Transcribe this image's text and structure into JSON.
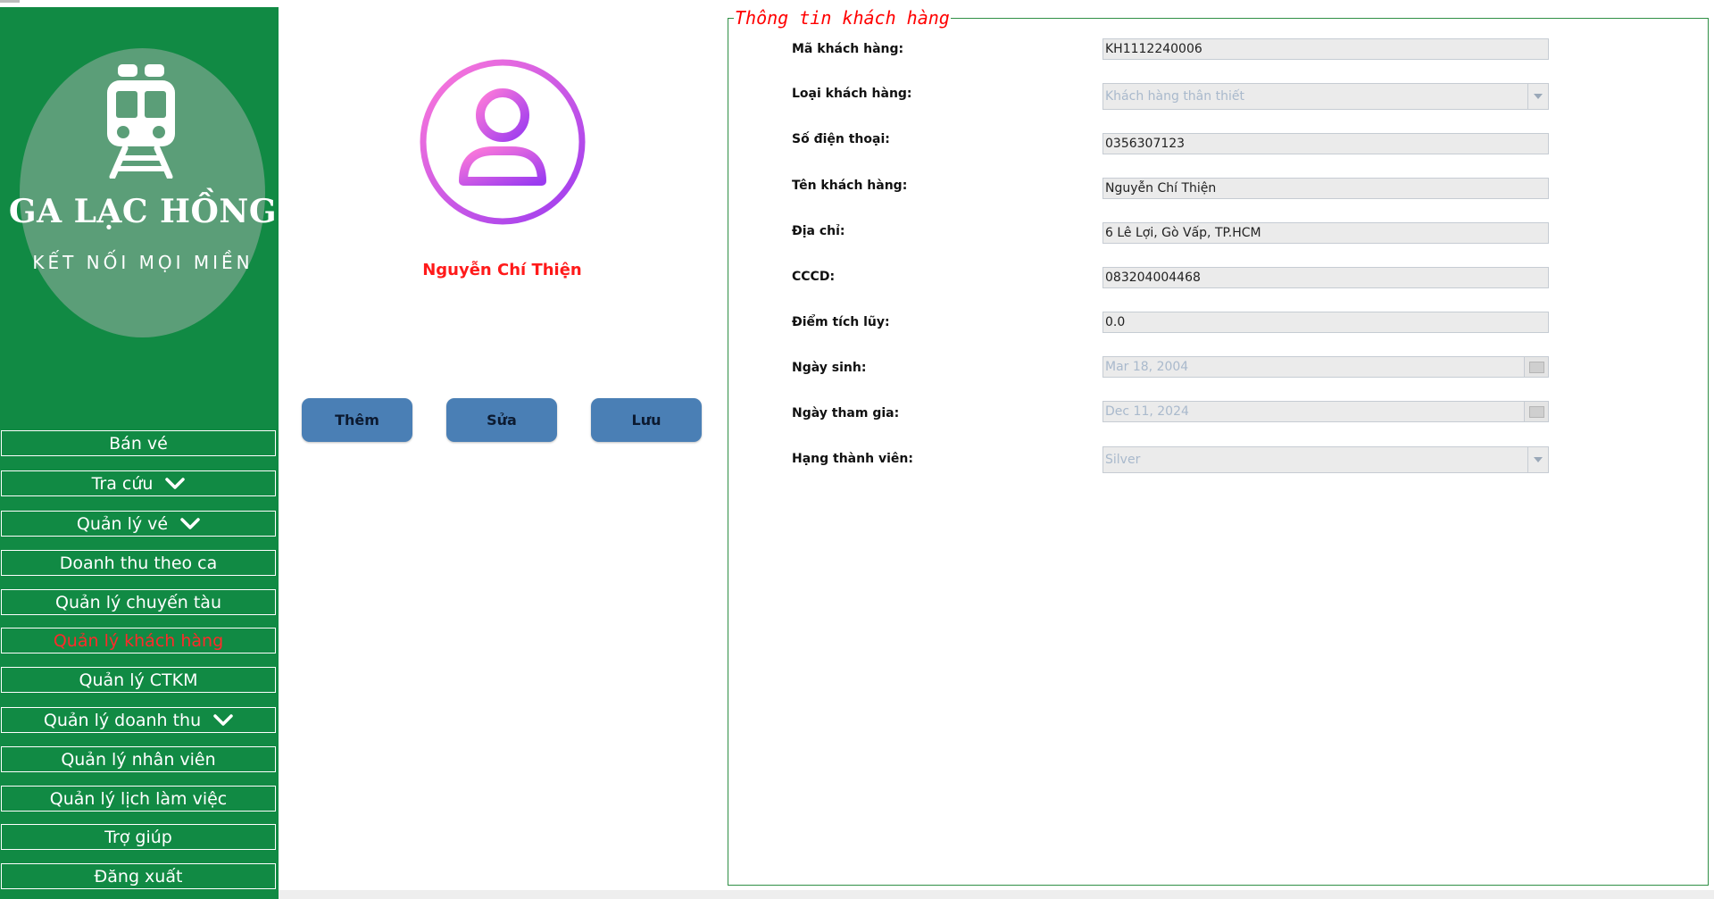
{
  "logo": {
    "title": "GA LẠC HỒNG",
    "tagline": "KẾT NỐI MỌI MIỀN",
    "icon": "train-icon"
  },
  "sidebar": {
    "items": [
      {
        "label": "Bán vé",
        "dropdown": false
      },
      {
        "label": "Tra cứu",
        "dropdown": true
      },
      {
        "label": "Quản lý vé",
        "dropdown": true
      },
      {
        "label": "Doanh thu theo ca",
        "dropdown": false
      },
      {
        "label": "Quản lý chuyến tàu",
        "dropdown": false
      },
      {
        "label": "Quản lý khách hàng",
        "dropdown": false,
        "active": true
      },
      {
        "label": "Quản lý CTKM",
        "dropdown": false
      },
      {
        "label": "Quản lý doanh thu",
        "dropdown": true
      },
      {
        "label": "Quản lý nhân viên",
        "dropdown": false
      },
      {
        "label": "Quản lý lịch làm việc",
        "dropdown": false
      },
      {
        "label": "Trợ giúp",
        "dropdown": false
      },
      {
        "label": "Đăng xuất",
        "dropdown": false
      }
    ]
  },
  "profile": {
    "avatar_icon": "user-avatar-icon",
    "name": "Nguyễn Chí Thiện"
  },
  "actions": {
    "add_label": "Thêm",
    "edit_label": "Sửa",
    "save_label": "Lưu"
  },
  "panel": {
    "title": "Thông tin khách hàng",
    "fields": {
      "ma_kh": {
        "label": "Mã khách hàng:",
        "value": "KH1112240006"
      },
      "loai_kh": {
        "label": "Loại khách hàng:",
        "value": "Khách hàng thân thiết"
      },
      "sdt": {
        "label": "Số điện thoại:",
        "value": "0356307123"
      },
      "ten_kh": {
        "label": "Tên khách hàng:",
        "value": "Nguyễn Chí Thiện"
      },
      "dia_chi": {
        "label": "Địa chỉ:",
        "value": "6 Lê Lợi, Gò Vấp, TP.HCM"
      },
      "cccd": {
        "label": "CCCD:",
        "value": "083204004468"
      },
      "diem": {
        "label": "Điểm tích lũy:",
        "value": "0.0"
      },
      "ngay_sinh": {
        "label": "Ngày sinh:",
        "value": "Mar 18, 2004"
      },
      "ngay_tham_gia": {
        "label": "Ngày tham gia:",
        "value": "Dec 11, 2024"
      },
      "hang_tv": {
        "label": "Hạng thành viên:",
        "value": "Silver"
      }
    }
  },
  "colors": {
    "sidebar_bg": "#118a44",
    "active_text": "#ff2a2a",
    "button_bg": "#4a7fb5",
    "avatar_gradient": [
      "#ff7ad9",
      "#9b3bf0"
    ],
    "panel_border": "#2f8f45"
  }
}
